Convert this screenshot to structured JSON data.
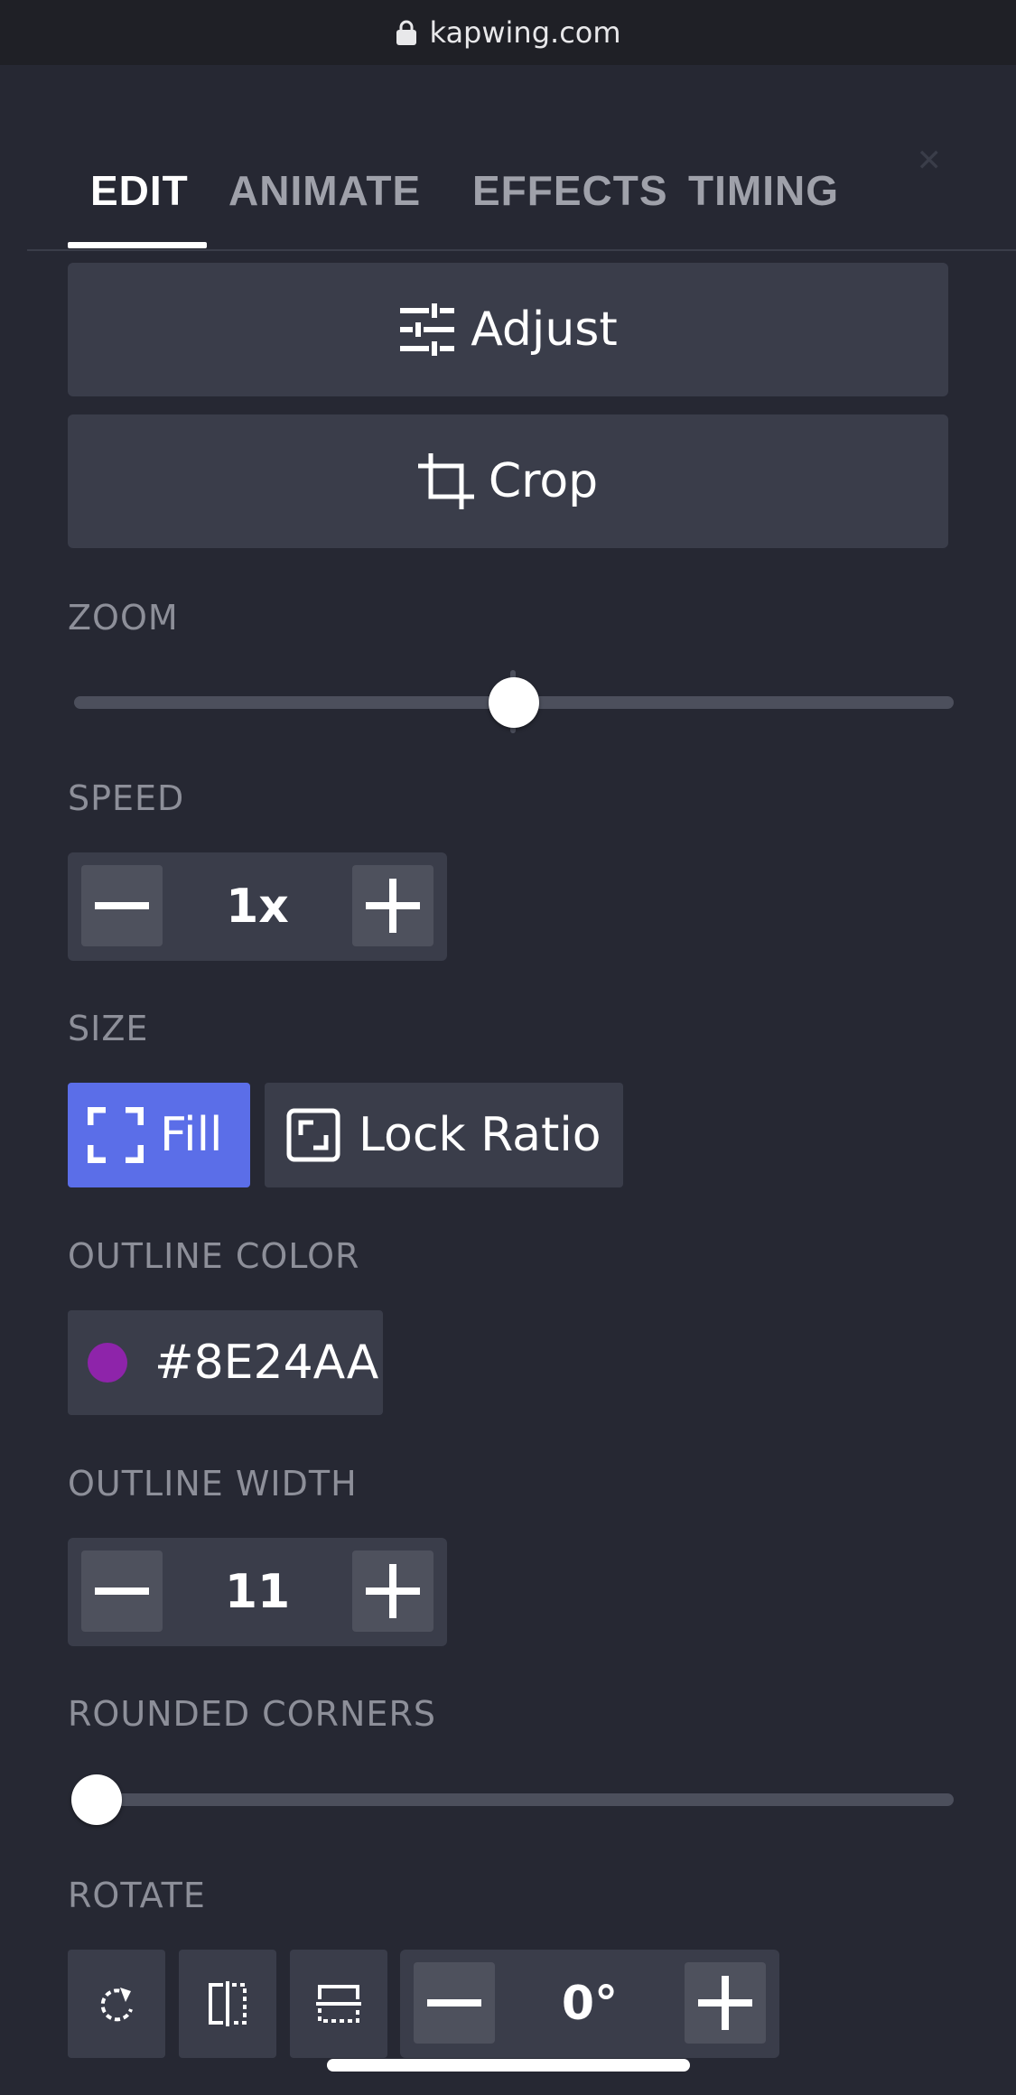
{
  "browser": {
    "url": "kapwing.com"
  },
  "tabs": [
    {
      "label": "EDIT",
      "active": true
    },
    {
      "label": "ANIMATE",
      "active": false
    },
    {
      "label": "EFFECTS",
      "active": false
    },
    {
      "label": "TIMING",
      "active": false
    }
  ],
  "actions": {
    "adjust_label": "Adjust",
    "crop_label": "Crop"
  },
  "zoom": {
    "label": "ZOOM",
    "value": 0.5
  },
  "speed": {
    "label": "SPEED",
    "value": "1x"
  },
  "size": {
    "label": "SIZE",
    "fill_label": "Fill",
    "lock_ratio_label": "Lock Ratio",
    "selected": "Fill"
  },
  "outline_color": {
    "label": "OUTLINE COLOR",
    "value": "#8E24AA",
    "swatch": "#8E24AA"
  },
  "outline_width": {
    "label": "OUTLINE WIDTH",
    "value": "11"
  },
  "rounded_corners": {
    "label": "ROUNDED CORNERS",
    "value": 0
  },
  "rotate": {
    "label": "ROTATE",
    "value": "0°"
  },
  "colors": {
    "accent": "#5b6ee8",
    "background": "#262833",
    "panel": "#3a3d4a"
  },
  "icons": [
    "lock-icon",
    "close-icon",
    "adjust-icon",
    "crop-icon",
    "minus-icon",
    "plus-icon",
    "fill-icon",
    "lock-ratio-icon",
    "rotate-icon",
    "flip-horizontal-icon",
    "flip-vertical-icon"
  ]
}
